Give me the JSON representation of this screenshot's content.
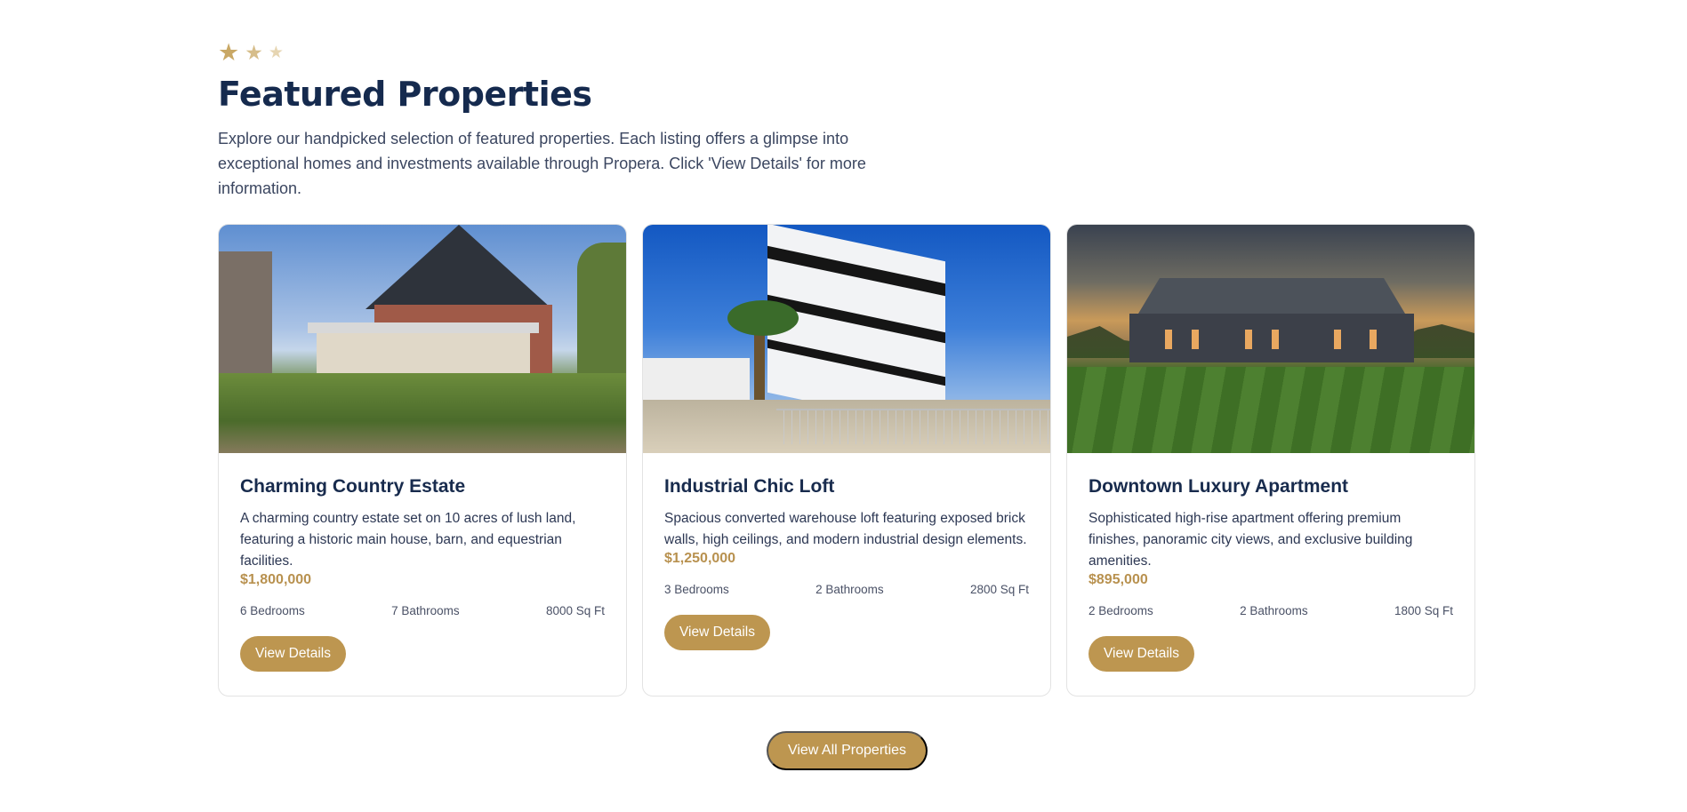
{
  "section": {
    "rating_stars": 3,
    "title": "Featured Properties",
    "intro": "Explore our handpicked selection of featured properties. Each listing offers a glimpse into exceptional homes and investments available through Propera. Click 'View Details' for more information."
  },
  "properties": [
    {
      "title": "Charming Country Estate",
      "description": "A charming country estate set on 10 acres of lush land, featuring a historic main house, barn, and equestrian facilities.",
      "price": "$1,800,000",
      "bedrooms": "6 Bedrooms",
      "bathrooms": "7 Bathrooms",
      "area": "8000 Sq Ft",
      "button": "View Details"
    },
    {
      "title": "Industrial Chic Loft",
      "description": "Spacious converted warehouse loft featuring exposed brick walls, high ceilings, and modern industrial design elements.",
      "price": "$1,250,000",
      "bedrooms": "3 Bedrooms",
      "bathrooms": "2 Bathrooms",
      "area": "2800 Sq Ft",
      "button": "View Details"
    },
    {
      "title": "Downtown Luxury Apartment",
      "description": "Sophisticated high-rise apartment offering premium finishes, panoramic city views, and exclusive building amenities.",
      "price": "$895,000",
      "bedrooms": "2 Bedrooms",
      "bathrooms": "2 Bathrooms",
      "area": "1800 Sq Ft",
      "button": "View Details"
    }
  ],
  "view_all_button": "View All Properties",
  "colors": {
    "accent": "#bd9650",
    "heading": "#152a4e",
    "text": "#2c3753"
  },
  "icons": [
    "star-icon"
  ]
}
